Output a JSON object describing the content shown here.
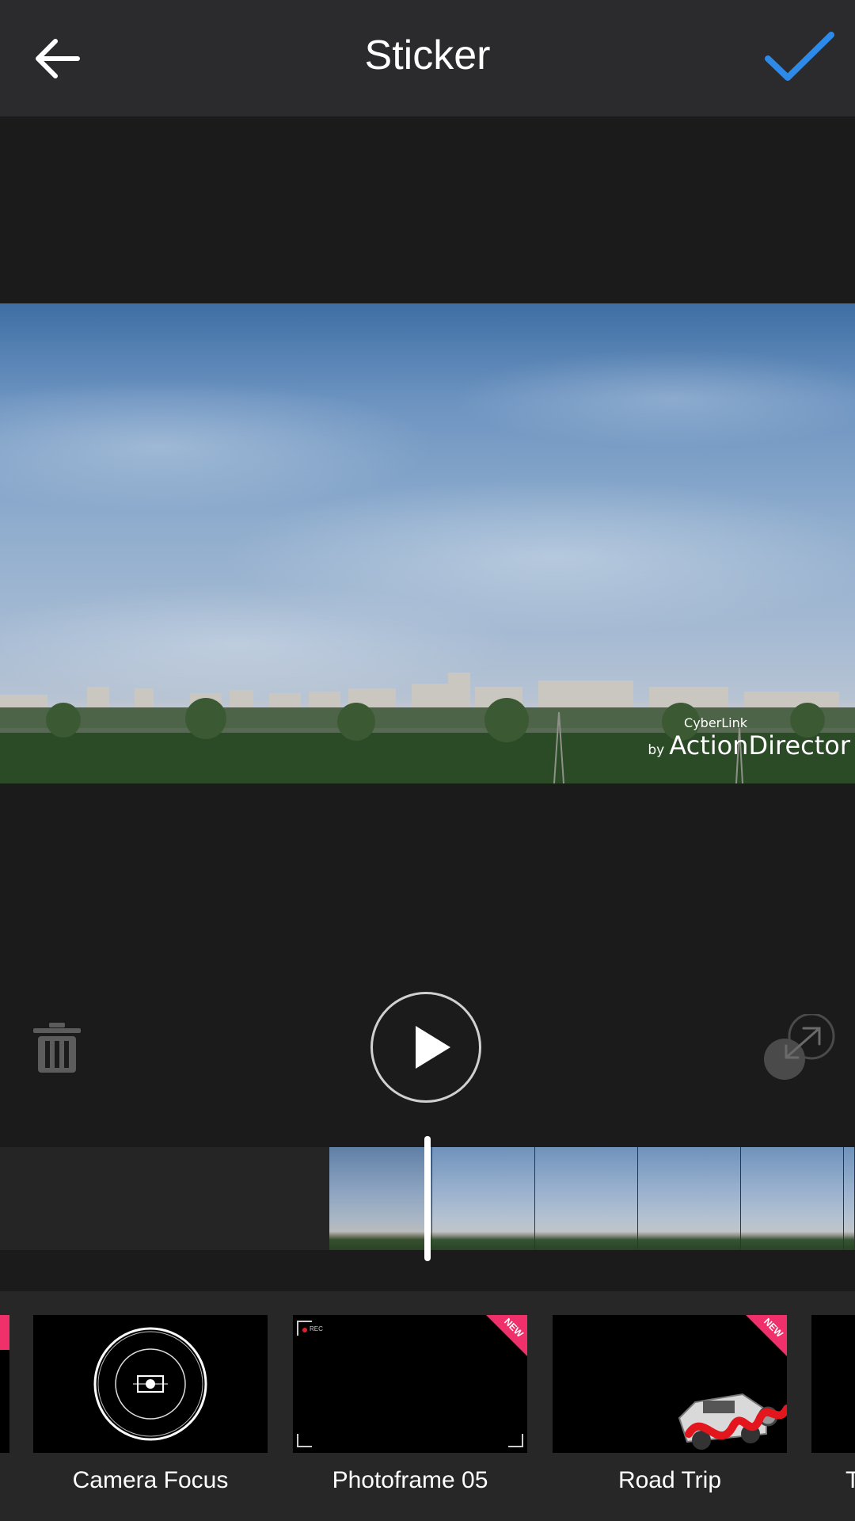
{
  "header": {
    "title": "Sticker",
    "back_icon": "arrow-left-icon",
    "confirm_icon": "checkmark-icon",
    "confirm_color": "#2d8ae8"
  },
  "preview": {
    "watermark_brand": "CyberLink",
    "watermark_by": "by",
    "watermark_product": "ActionDirector"
  },
  "controls": {
    "delete_icon": "trash-icon",
    "play_icon": "play-icon",
    "resize_icon": "resize-icon"
  },
  "stickers": {
    "items": [
      {
        "label": "Camera Focus",
        "new": false
      },
      {
        "label": "Photoframe 05",
        "new": true
      },
      {
        "label": "Road Trip",
        "new": true
      }
    ],
    "partial_right_label": "T",
    "new_badge_text": "NEW",
    "rec_text": "REC",
    "accent": "#f0306b"
  }
}
